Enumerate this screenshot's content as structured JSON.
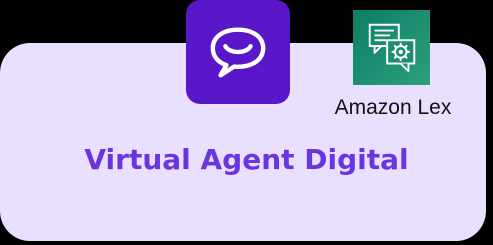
{
  "card": {
    "title": "Virtual Agent Digital"
  },
  "service": {
    "label": "Amazon Lex"
  },
  "icons": {
    "agent": "chat-smile-icon",
    "lex": "amazon-lex-chat-gear-icon"
  },
  "colors": {
    "card_background": "#e9e0ff",
    "agent_tile": "#5a17c9",
    "title_text": "#6a35e0",
    "lex_tile": "#1a8f6f",
    "page_background": "#000000"
  }
}
